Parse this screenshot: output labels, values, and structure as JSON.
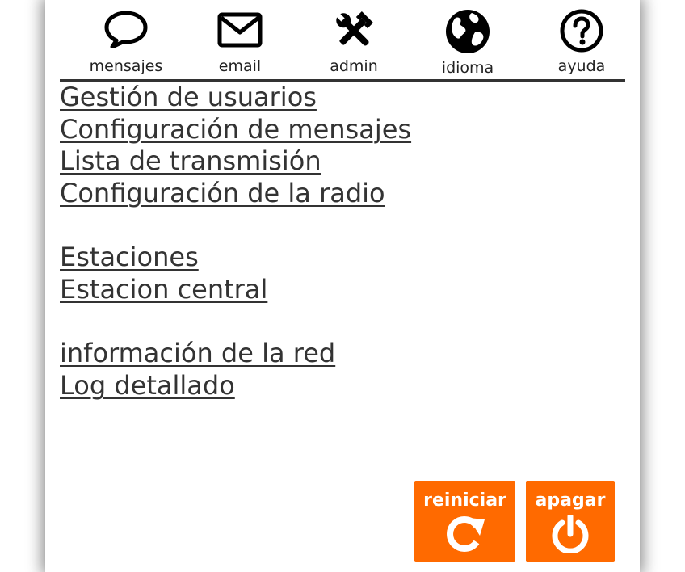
{
  "nav": {
    "items": [
      {
        "label": "mensajes",
        "icon": "chat-bubble-icon"
      },
      {
        "label": "email",
        "icon": "envelope-icon"
      },
      {
        "label": "admin",
        "icon": "tools-icon"
      },
      {
        "label": "idioma",
        "icon": "globe-icon"
      },
      {
        "label": "ayuda",
        "icon": "help-icon"
      }
    ]
  },
  "menu": {
    "group1": [
      "Gestión de usuarios",
      "Configuración de mensajes",
      "Lista de transmisión",
      "Configuración de la radio"
    ],
    "group2": [
      "Estaciones",
      "Estacion central"
    ],
    "group3": [
      "información de la red",
      "Log detallado"
    ]
  },
  "actions": {
    "restart_label": "reiniciar",
    "shutdown_label": "apagar"
  },
  "colors": {
    "accent": "#ff6a00",
    "text": "#333333",
    "divider": "#333333"
  }
}
